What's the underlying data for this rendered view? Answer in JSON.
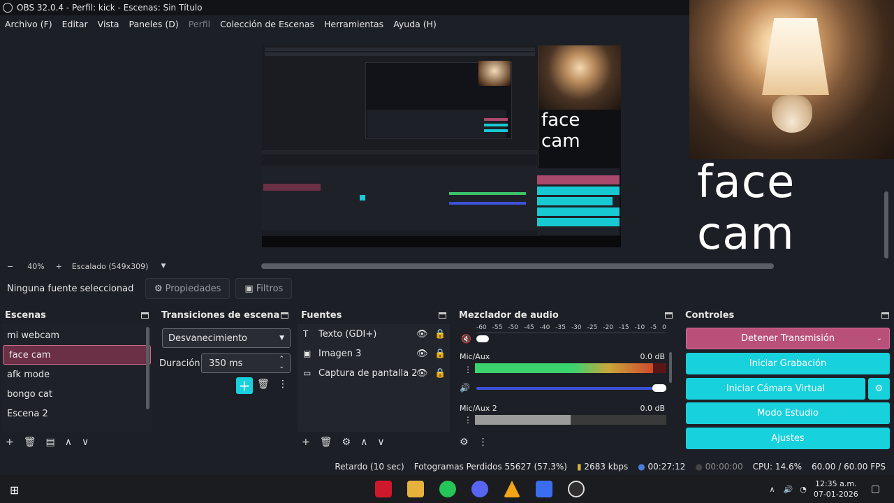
{
  "window": {
    "title": "OBS 32.0.4 - Perfil: kick - Escenas: Sin Título"
  },
  "menu": {
    "items": [
      "Archivo (F)",
      "Editar",
      "Vista",
      "Paneles (D)",
      "Perfil",
      "Colección de Escenas",
      "Herramientas",
      "Ayuda (H)"
    ]
  },
  "preview": {
    "camera_label": "face cam",
    "nested_camera_label": "face cam",
    "zoom": "40%",
    "zoom_minus": "−",
    "zoom_plus": "+",
    "scale_label": "Escalado (549x309)"
  },
  "source_bar": {
    "no_selection": "Ninguna fuente seleccionad",
    "properties": "Propiedades",
    "filters": "Filtros"
  },
  "scenes": {
    "title": "Escenas",
    "items": [
      "mi webcam",
      "face cam",
      "afk mode",
      "bongo cat",
      "Escena 2"
    ],
    "active": "face cam"
  },
  "transitions": {
    "title": "Transiciones de escena",
    "selected": "Desvanecimiento",
    "duration_label": "Duración",
    "duration_value": "350 ms"
  },
  "sources": {
    "title": "Fuentes",
    "items": [
      {
        "icon": "text-icon",
        "label": "Texto (GDI+)"
      },
      {
        "icon": "image-icon",
        "label": "Imagen 3"
      },
      {
        "icon": "monitor-icon",
        "label": "Captura de pantalla 2"
      }
    ]
  },
  "mixer": {
    "title": "Mezclador de audio",
    "ticks": [
      "-60",
      "-55",
      "-50",
      "-45",
      "-40",
      "-35",
      "-30",
      "-25",
      "-20",
      "-15",
      "-10",
      "-5",
      "0"
    ],
    "channels": [
      {
        "name": "Mic/Aux",
        "db": "0.0 dB",
        "level": 0.93
      },
      {
        "name": "Mic/Aux 2",
        "db": "0.0 dB",
        "level": 0.5
      }
    ]
  },
  "controls": {
    "title": "Controles",
    "stop_stream": "Detener Transmisión",
    "start_recording": "Iniciar Grabación",
    "start_virtual_cam": "Iniciar Cámara Virtual",
    "studio_mode": "Modo Estudio",
    "settings": "Ajustes"
  },
  "status": {
    "delay": "Retardo (10 sec)",
    "dropped": "Fotogramas Perdidos 55627 (57.3%)",
    "bitrate": "2683 kbps",
    "stream_time": "00:27:12",
    "rec_time": "00:00:00",
    "cpu": "CPU: 14.6%",
    "fps": "60.00 / 60.00 FPS"
  },
  "taskbar": {
    "time": "12:35 a.m.",
    "date": "07-01-2026"
  },
  "colors": {
    "accent": "#17d1dc",
    "stop": "#b9507a",
    "selection": "#6b3045"
  }
}
